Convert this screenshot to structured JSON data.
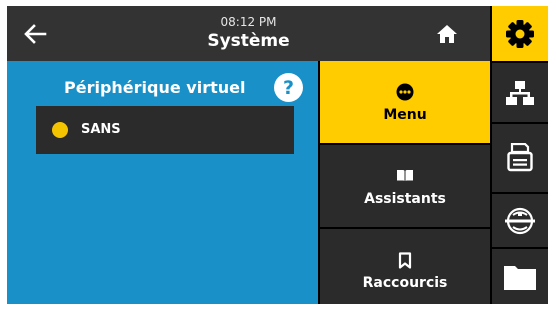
{
  "header": {
    "time": "08:12 PM",
    "title": "Système"
  },
  "left_pane": {
    "title": "Périphérique virtuel",
    "help_icon": "?",
    "option": {
      "label": "SANS",
      "status_color": "#f5c400"
    }
  },
  "menu": {
    "items": [
      {
        "label": "Menu",
        "icon": "menu-dots-icon",
        "active": true
      },
      {
        "label": "Assistants",
        "icon": "book-icon",
        "active": false
      },
      {
        "label": "Raccourcis",
        "icon": "bookmark-icon",
        "active": false
      }
    ]
  },
  "sidebar": {
    "items": [
      {
        "icon": "gear-icon",
        "active": true
      },
      {
        "icon": "network-icon",
        "active": false
      },
      {
        "icon": "printer-icon",
        "active": false
      },
      {
        "icon": "sensor-icon",
        "active": false
      },
      {
        "icon": "folder-icon",
        "active": false
      }
    ]
  },
  "colors": {
    "accent": "#ffcc00",
    "pane_blue": "#1a90c8",
    "dark": "#2b2b2b",
    "header": "#333333"
  }
}
